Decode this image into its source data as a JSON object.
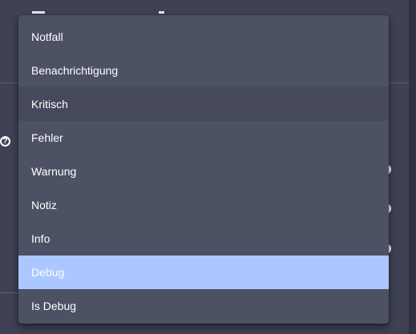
{
  "dropdown": {
    "options": [
      {
        "label": "Notfall"
      },
      {
        "label": "Benachrichtigung"
      },
      {
        "label": "Kritisch"
      },
      {
        "label": "Fehler"
      },
      {
        "label": "Warnung"
      },
      {
        "label": "Notiz"
      },
      {
        "label": "Info"
      },
      {
        "label": "Debug"
      },
      {
        "label": "Is Debug"
      }
    ],
    "hovered_index": 2,
    "selected_index": 7
  },
  "background": {
    "help_icon": "question-circle-icon"
  },
  "colors": {
    "menu_background": "#4c5164",
    "hover_background": "#45495b",
    "selected_background": "#aac8ff",
    "page_background": "#3e4254"
  }
}
